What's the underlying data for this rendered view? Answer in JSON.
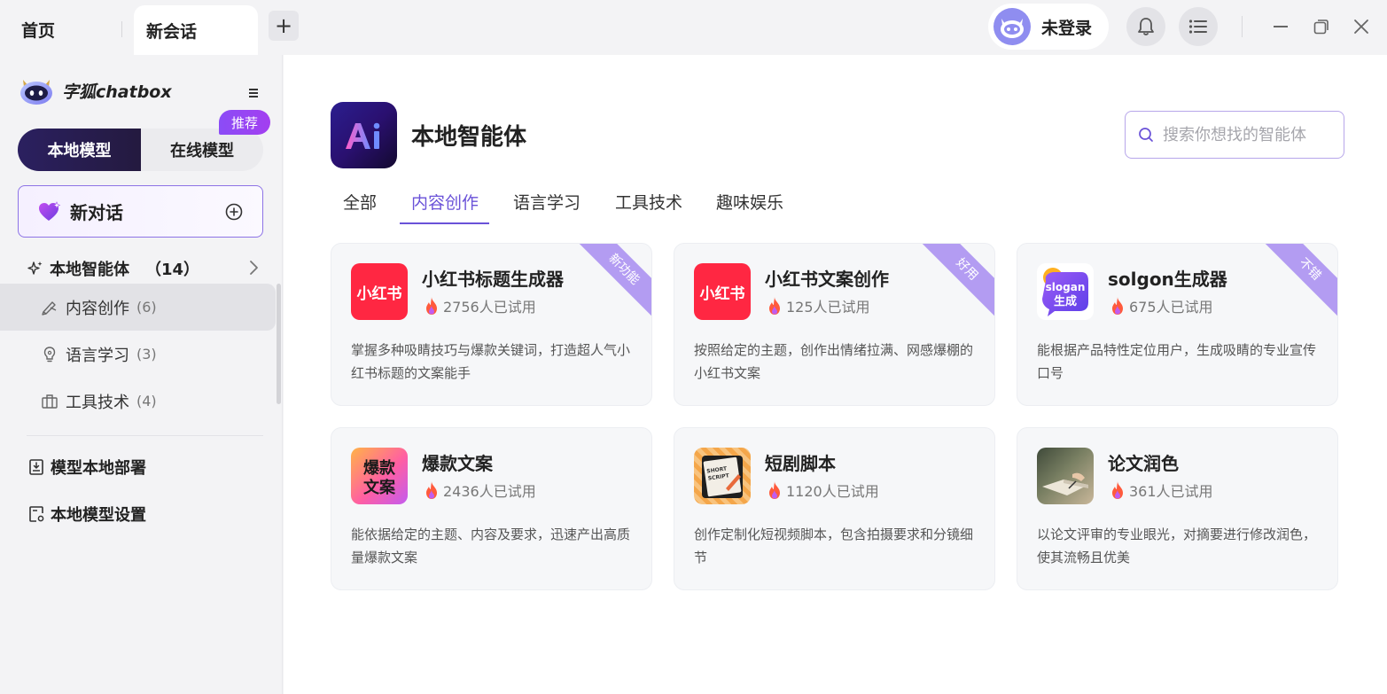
{
  "tabs": {
    "home": "首页",
    "active": "新会话",
    "add": "+"
  },
  "user": {
    "login_label": "未登录"
  },
  "sidebar": {
    "app_name": "字狐chatbox",
    "mode_local": "本地模型",
    "mode_online": "在线模型",
    "recommend_badge": "推荐",
    "new_chat": "新对话",
    "section_title": "本地智能体",
    "section_count": "（14）",
    "items": [
      {
        "label": "内容创作",
        "count": "(6)",
        "icon": "palette-icon",
        "active": true
      },
      {
        "label": "语言学习",
        "count": "(3)",
        "icon": "lightbulb-icon",
        "active": false
      },
      {
        "label": "工具技术",
        "count": "(4)",
        "icon": "toolbox-icon",
        "active": false
      }
    ],
    "links": [
      {
        "label": "模型本地部署",
        "icon": "deploy-icon"
      },
      {
        "label": "本地模型设置",
        "icon": "settings-doc-icon"
      }
    ]
  },
  "main": {
    "title": "本地智能体",
    "search_placeholder": "搜索你想找的智能体",
    "category_tabs": [
      "全部",
      "内容创作",
      "语言学习",
      "工具技术",
      "趣味娱乐"
    ],
    "active_tab": "内容创作",
    "cards": [
      {
        "title": "小红书标题生成器",
        "usage": "2756人已试用",
        "desc": "掌握多种吸睛技巧与爆款关键词，打造超人气小红书标题的文案能手",
        "ribbon": "新功能",
        "icon_text": "小红书",
        "icon": "xiaohongshu-icon"
      },
      {
        "title": "小红书文案创作",
        "usage": "125人已试用",
        "desc": "按照给定的主题，创作出情绪拉满、网感爆棚的小红书文案",
        "ribbon": "好用",
        "icon_text": "小红书",
        "icon": "xiaohongshu-icon"
      },
      {
        "title": "solgon生成器",
        "usage": "675人已试用",
        "desc": "能根据产品特性定位用户，生成吸睛的专业宣传口号",
        "ribbon": "不错",
        "icon_text": "slogan\n生成",
        "icon": "slogan-icon"
      },
      {
        "title": "爆款文案",
        "usage": "2436人已试用",
        "desc": "能依据给定的主题、内容及要求，迅速产出高质量爆款文案",
        "ribbon": "",
        "icon_text": "爆款\n文案",
        "icon": "hot-copy-icon"
      },
      {
        "title": "短剧脚本",
        "usage": "1120人已试用",
        "desc": "创作定制化短视频脚本，包含拍摄要求和分镜细节",
        "ribbon": "",
        "icon_text": "SHORT SCRIPT",
        "icon": "script-icon"
      },
      {
        "title": "论文润色",
        "usage": "361人已试用",
        "desc": "以论文评审的专业眼光，对摘要进行修改润色，使其流畅且优美",
        "ribbon": "",
        "icon_text": "",
        "icon": "writing-photo-icon"
      }
    ]
  },
  "colors": {
    "accent": "#6a52d8",
    "ribbon": "#b39cf2",
    "xiaohongshu_red": "#ff2742"
  }
}
